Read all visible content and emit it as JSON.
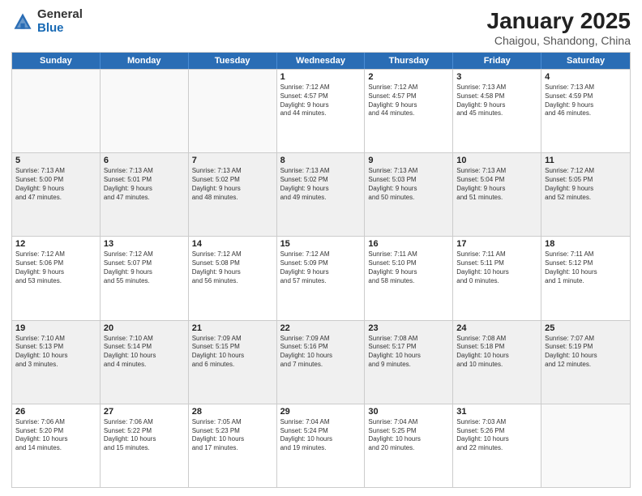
{
  "logo": {
    "general": "General",
    "blue": "Blue"
  },
  "title": {
    "month": "January 2025",
    "location": "Chaigou, Shandong, China"
  },
  "days": [
    "Sunday",
    "Monday",
    "Tuesday",
    "Wednesday",
    "Thursday",
    "Friday",
    "Saturday"
  ],
  "rows": [
    [
      {
        "day": "",
        "text": ""
      },
      {
        "day": "",
        "text": ""
      },
      {
        "day": "",
        "text": ""
      },
      {
        "day": "1",
        "text": "Sunrise: 7:12 AM\nSunset: 4:57 PM\nDaylight: 9 hours\nand 44 minutes."
      },
      {
        "day": "2",
        "text": "Sunrise: 7:12 AM\nSunset: 4:57 PM\nDaylight: 9 hours\nand 44 minutes."
      },
      {
        "day": "3",
        "text": "Sunrise: 7:13 AM\nSunset: 4:58 PM\nDaylight: 9 hours\nand 45 minutes."
      },
      {
        "day": "4",
        "text": "Sunrise: 7:13 AM\nSunset: 4:59 PM\nDaylight: 9 hours\nand 46 minutes."
      }
    ],
    [
      {
        "day": "5",
        "text": "Sunrise: 7:13 AM\nSunset: 5:00 PM\nDaylight: 9 hours\nand 47 minutes."
      },
      {
        "day": "6",
        "text": "Sunrise: 7:13 AM\nSunset: 5:01 PM\nDaylight: 9 hours\nand 47 minutes."
      },
      {
        "day": "7",
        "text": "Sunrise: 7:13 AM\nSunset: 5:02 PM\nDaylight: 9 hours\nand 48 minutes."
      },
      {
        "day": "8",
        "text": "Sunrise: 7:13 AM\nSunset: 5:02 PM\nDaylight: 9 hours\nand 49 minutes."
      },
      {
        "day": "9",
        "text": "Sunrise: 7:13 AM\nSunset: 5:03 PM\nDaylight: 9 hours\nand 50 minutes."
      },
      {
        "day": "10",
        "text": "Sunrise: 7:13 AM\nSunset: 5:04 PM\nDaylight: 9 hours\nand 51 minutes."
      },
      {
        "day": "11",
        "text": "Sunrise: 7:12 AM\nSunset: 5:05 PM\nDaylight: 9 hours\nand 52 minutes."
      }
    ],
    [
      {
        "day": "12",
        "text": "Sunrise: 7:12 AM\nSunset: 5:06 PM\nDaylight: 9 hours\nand 53 minutes."
      },
      {
        "day": "13",
        "text": "Sunrise: 7:12 AM\nSunset: 5:07 PM\nDaylight: 9 hours\nand 55 minutes."
      },
      {
        "day": "14",
        "text": "Sunrise: 7:12 AM\nSunset: 5:08 PM\nDaylight: 9 hours\nand 56 minutes."
      },
      {
        "day": "15",
        "text": "Sunrise: 7:12 AM\nSunset: 5:09 PM\nDaylight: 9 hours\nand 57 minutes."
      },
      {
        "day": "16",
        "text": "Sunrise: 7:11 AM\nSunset: 5:10 PM\nDaylight: 9 hours\nand 58 minutes."
      },
      {
        "day": "17",
        "text": "Sunrise: 7:11 AM\nSunset: 5:11 PM\nDaylight: 10 hours\nand 0 minutes."
      },
      {
        "day": "18",
        "text": "Sunrise: 7:11 AM\nSunset: 5:12 PM\nDaylight: 10 hours\nand 1 minute."
      }
    ],
    [
      {
        "day": "19",
        "text": "Sunrise: 7:10 AM\nSunset: 5:13 PM\nDaylight: 10 hours\nand 3 minutes."
      },
      {
        "day": "20",
        "text": "Sunrise: 7:10 AM\nSunset: 5:14 PM\nDaylight: 10 hours\nand 4 minutes."
      },
      {
        "day": "21",
        "text": "Sunrise: 7:09 AM\nSunset: 5:15 PM\nDaylight: 10 hours\nand 6 minutes."
      },
      {
        "day": "22",
        "text": "Sunrise: 7:09 AM\nSunset: 5:16 PM\nDaylight: 10 hours\nand 7 minutes."
      },
      {
        "day": "23",
        "text": "Sunrise: 7:08 AM\nSunset: 5:17 PM\nDaylight: 10 hours\nand 9 minutes."
      },
      {
        "day": "24",
        "text": "Sunrise: 7:08 AM\nSunset: 5:18 PM\nDaylight: 10 hours\nand 10 minutes."
      },
      {
        "day": "25",
        "text": "Sunrise: 7:07 AM\nSunset: 5:19 PM\nDaylight: 10 hours\nand 12 minutes."
      }
    ],
    [
      {
        "day": "26",
        "text": "Sunrise: 7:06 AM\nSunset: 5:20 PM\nDaylight: 10 hours\nand 14 minutes."
      },
      {
        "day": "27",
        "text": "Sunrise: 7:06 AM\nSunset: 5:22 PM\nDaylight: 10 hours\nand 15 minutes."
      },
      {
        "day": "28",
        "text": "Sunrise: 7:05 AM\nSunset: 5:23 PM\nDaylight: 10 hours\nand 17 minutes."
      },
      {
        "day": "29",
        "text": "Sunrise: 7:04 AM\nSunset: 5:24 PM\nDaylight: 10 hours\nand 19 minutes."
      },
      {
        "day": "30",
        "text": "Sunrise: 7:04 AM\nSunset: 5:25 PM\nDaylight: 10 hours\nand 20 minutes."
      },
      {
        "day": "31",
        "text": "Sunrise: 7:03 AM\nSunset: 5:26 PM\nDaylight: 10 hours\nand 22 minutes."
      },
      {
        "day": "",
        "text": ""
      }
    ]
  ]
}
